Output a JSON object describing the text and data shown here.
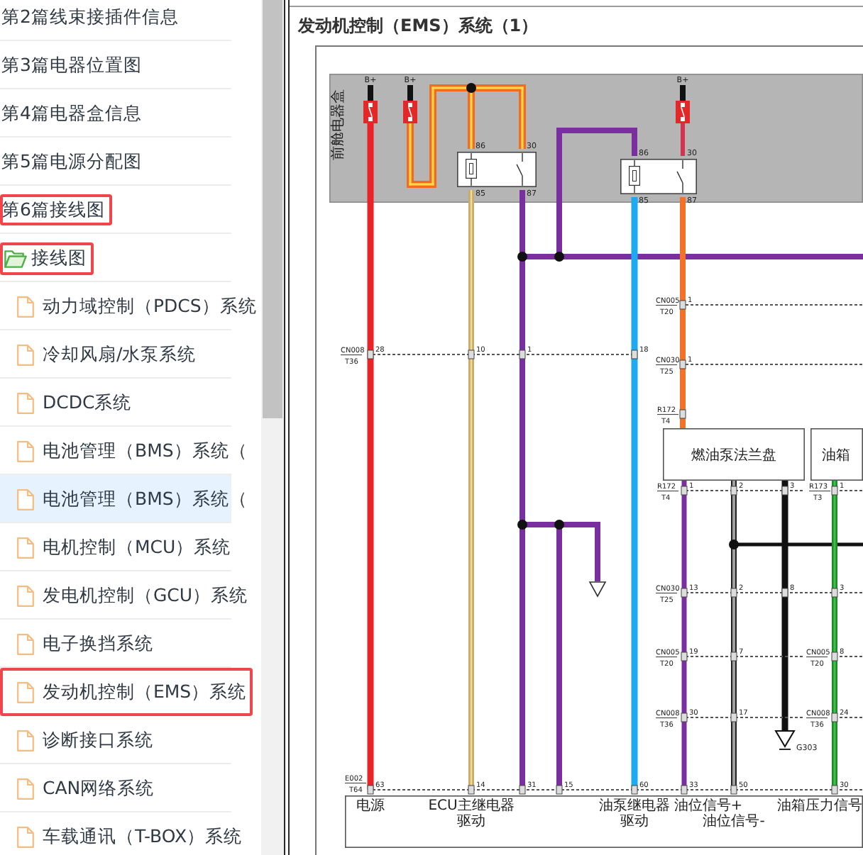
{
  "sidebar": {
    "tree": [
      {
        "kind": "chapter",
        "label": "第2篇线束接插件信息",
        "selected": false,
        "highlighted": false
      },
      {
        "kind": "chapter",
        "label": "第3篇电器位置图",
        "selected": false,
        "highlighted": false
      },
      {
        "kind": "chapter",
        "label": "第4篇电器盒信息",
        "selected": false,
        "highlighted": false
      },
      {
        "kind": "chapter",
        "label": "第5篇电源分配图",
        "selected": false,
        "highlighted": false
      },
      {
        "kind": "chapter",
        "label": "第6篇接线图",
        "selected": false,
        "highlighted": true,
        "children": [
          {
            "kind": "folder",
            "label": "接线图",
            "selected": false,
            "highlighted": true,
            "children": [
              {
                "kind": "file",
                "label": "动力域控制（PDCS）系统",
                "selected": false,
                "highlighted": false
              },
              {
                "kind": "file",
                "label": "冷却风扇/水泵系统",
                "selected": false,
                "highlighted": false
              },
              {
                "kind": "file",
                "label": "DCDC系统",
                "selected": false,
                "highlighted": false
              },
              {
                "kind": "file",
                "label": "电池管理（BMS）系统（",
                "selected": false,
                "highlighted": false
              },
              {
                "kind": "file",
                "label": "电池管理（BMS）系统（",
                "selected": true,
                "highlighted": false
              },
              {
                "kind": "file",
                "label": "电机控制（MCU）系统",
                "selected": false,
                "highlighted": false
              },
              {
                "kind": "file",
                "label": "发电机控制（GCU）系统",
                "selected": false,
                "highlighted": false
              },
              {
                "kind": "file",
                "label": "电子换挡系统",
                "selected": false,
                "highlighted": false
              },
              {
                "kind": "file",
                "label": "发动机控制（EMS）系统",
                "selected": false,
                "highlighted": true
              },
              {
                "kind": "file",
                "label": "诊断接口系统",
                "selected": false,
                "highlighted": false
              },
              {
                "kind": "file",
                "label": "CAN网络系统",
                "selected": false,
                "highlighted": false
              },
              {
                "kind": "file",
                "label": "车载通讯（T-BOX）系统",
                "selected": false,
                "highlighted": false
              }
            ]
          }
        ]
      }
    ]
  },
  "document": {
    "title": "发动机控制（EMS）系统（1）",
    "diagram": {
      "fuse_box": {
        "label": "前舱电器盒"
      },
      "fuses": [
        {
          "supply": "B+"
        },
        {
          "supply": "B+"
        },
        {
          "supply": "B+"
        }
      ],
      "relays": [
        {
          "pins": [
            "86",
            "30",
            "85",
            "87"
          ]
        },
        {
          "pins": [
            "86",
            "30",
            "85",
            "87"
          ]
        }
      ],
      "connectors": [
        {
          "name": "CN005",
          "cavity": "T20",
          "pins": [
            "1"
          ]
        },
        {
          "name": "CN008",
          "cavity": "T36",
          "pins": [
            "28",
            "10",
            "1",
            "18"
          ]
        },
        {
          "name": "CN030",
          "cavity": "T25",
          "pins": [
            "1"
          ]
        },
        {
          "name": "R172",
          "cavity": "T4"
        },
        {
          "name": "R172",
          "cavity": "T4",
          "pins": [
            "1",
            "2",
            "3"
          ]
        },
        {
          "name": "R173",
          "cavity": "T3",
          "pins": [
            "1"
          ]
        },
        {
          "name": "CN030",
          "cavity": "T25",
          "pins": [
            "13",
            "2",
            "8",
            "3"
          ]
        },
        {
          "name": "CN005",
          "cavity": "T20",
          "pins": [
            "19",
            "7"
          ]
        },
        {
          "name": "CN005",
          "cavity": "T20",
          "pins": [
            "8"
          ]
        },
        {
          "name": "CN008",
          "cavity": "T36",
          "pins": [
            "30",
            "17"
          ]
        },
        {
          "name": "CN008",
          "cavity": "T36",
          "pins": [
            "24"
          ]
        },
        {
          "name": "E002",
          "cavity": "T64",
          "pins": [
            "63",
            "14",
            "31",
            "15",
            "60",
            "33",
            "50",
            "30"
          ]
        }
      ],
      "modules": [
        {
          "label": "燃油泵法兰盘"
        },
        {
          "label": "油箱"
        }
      ],
      "ground": {
        "label": "G303"
      },
      "ecu_pin_functions": [
        {
          "label": "电源"
        },
        {
          "label": "ECU主继电器驱动"
        },
        {
          "label": "油泵继电器驱动"
        },
        {
          "label": "油位信号+"
        },
        {
          "label": "油位信号-"
        },
        {
          "label": "油箱压力信号"
        }
      ]
    }
  }
}
